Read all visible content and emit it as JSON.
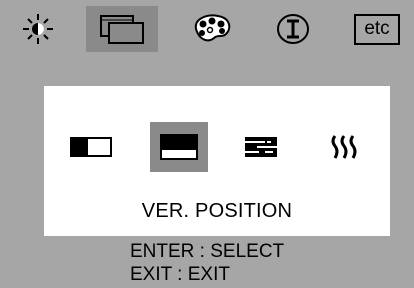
{
  "tabs": [
    {
      "icon": "brightness-icon",
      "active": false
    },
    {
      "icon": "geometry-icon",
      "active": true
    },
    {
      "icon": "color-palette-icon",
      "active": false
    },
    {
      "icon": "information-icon",
      "active": false
    },
    {
      "icon": "etc-label",
      "label": "etc",
      "active": false
    }
  ],
  "panel": {
    "items": [
      {
        "icon": "horizontal-position-icon",
        "selected": false
      },
      {
        "icon": "vertical-position-icon",
        "selected": true
      },
      {
        "icon": "phase-icon",
        "selected": false
      },
      {
        "icon": "moire-icon",
        "selected": false
      }
    ],
    "caption": "VER. POSITION"
  },
  "hints": {
    "enter": "ENTER : SELECT",
    "exit": "EXIT : EXIT"
  },
  "colors": {
    "background": "#a6a6a6",
    "highlight": "#8a8a8a",
    "panel": "#ffffff",
    "ink": "#000000"
  }
}
